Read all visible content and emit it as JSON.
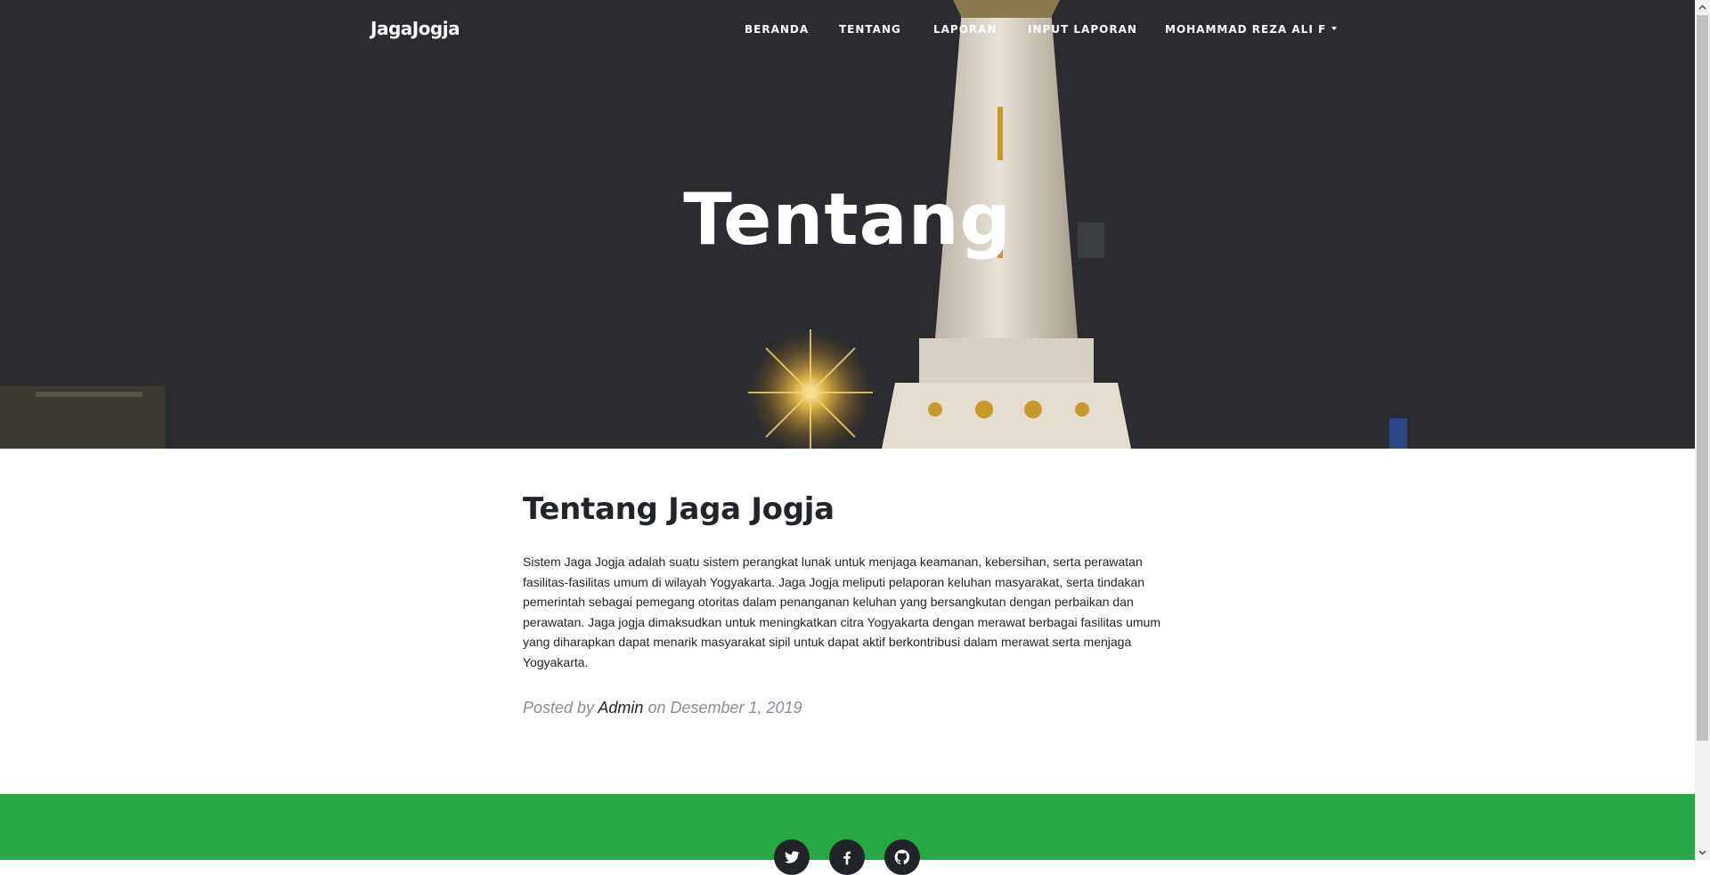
{
  "nav": {
    "brand": "JagaJogja",
    "items": [
      {
        "label": "BERANDA"
      },
      {
        "label": "TENTANG"
      },
      {
        "label": "LAPORAN"
      },
      {
        "label": "INPUT LAPORAN"
      },
      {
        "label": "MOHAMMAD REZA ALI F"
      }
    ]
  },
  "hero": {
    "title": "Tentang"
  },
  "article": {
    "title": "Tentang Jaga Jogja",
    "body": "Sistem Jaga Jogja adalah suatu sistem perangkat lunak untuk menjaga keamanan, kebersihan, serta perawatan fasilitas-fasilitas umum di wilayah Yogyakarta. Jaga Jogja meliputi pelaporan keluhan masyarakat, serta tindakan pemerintah sebagai pemegang otoritas dalam penanganan keluhan yang bersangkutan dengan perbaikan dan perawatan. Jaga jogja dimaksudkan untuk meningkatkan citra Yogyakarta dengan merawat berbagai fasilitas umum yang diharapkan dapat menarik masyarakat sipil untuk dapat aktif berkontribusi dalam merawat serta menjaga Yogyakarta.",
    "posted_by": "Posted by",
    "author": "Admin",
    "date_text": "on Desember 1, 2019"
  },
  "footer": {
    "social": [
      "twitter-icon",
      "facebook-icon",
      "github-icon"
    ],
    "color": "#28a745"
  },
  "colors": {
    "hero_bg": "#2a2c2f",
    "text": "#212529",
    "muted": "#868e96"
  }
}
